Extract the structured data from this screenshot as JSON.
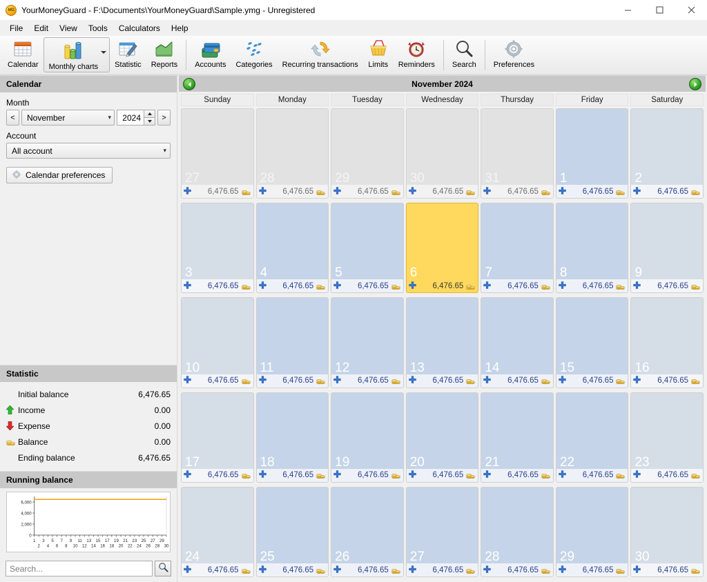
{
  "window": {
    "title": "YourMoneyGuard - F:\\Documents\\YourMoneyGuard\\Sample.ymg - Unregistered",
    "app_icon": "money-guard-icon",
    "minimize_label": "Minimize",
    "maximize_label": "Maximize",
    "close_label": "Close"
  },
  "menubar": {
    "items": [
      {
        "label": "File"
      },
      {
        "label": "Edit"
      },
      {
        "label": "View"
      },
      {
        "label": "Tools"
      },
      {
        "label": "Calculators"
      },
      {
        "label": "Help"
      }
    ]
  },
  "toolbar": {
    "items": [
      {
        "label": "Calendar",
        "icon": "calendar-icon",
        "active": false,
        "caret": false
      },
      {
        "label": "Monthly charts",
        "icon": "bar-chart-icon",
        "active": true,
        "caret": true
      },
      {
        "label": "Statistic",
        "icon": "statistic-icon",
        "active": false,
        "caret": false
      },
      {
        "label": "Reports",
        "icon": "reports-icon",
        "active": false,
        "caret": false
      },
      {
        "label": "Accounts",
        "icon": "credit-cards-icon",
        "active": false,
        "caret": false
      },
      {
        "label": "Categories",
        "icon": "categories-icon",
        "active": false,
        "caret": false
      },
      {
        "label": "Recurring transactions",
        "icon": "recurring-icon",
        "active": false,
        "caret": false
      },
      {
        "label": "Limits",
        "icon": "basket-icon",
        "active": false,
        "caret": false
      },
      {
        "label": "Reminders",
        "icon": "alarm-clock-icon",
        "active": false,
        "caret": false
      },
      {
        "label": "Search",
        "icon": "magnifier-icon",
        "active": false,
        "caret": false
      },
      {
        "label": "Preferences",
        "icon": "gear-icon",
        "active": false,
        "caret": false
      }
    ]
  },
  "sidebar": {
    "calendar_panel": {
      "header": "Calendar",
      "month_label": "Month",
      "prev_month_button": "<",
      "next_month_button": ">",
      "month_value": "November",
      "year_value": "2024",
      "account_label": "Account",
      "account_value": "All account",
      "preferences_button": "Calendar preferences"
    },
    "statistic_panel": {
      "header": "Statistic",
      "rows": [
        {
          "icon": "",
          "label": "Initial balance",
          "value": "6,476.65"
        },
        {
          "icon": "green-up-arrow-icon",
          "label": "Income",
          "value": "0.00"
        },
        {
          "icon": "red-down-arrow-icon",
          "label": "Expense",
          "value": "0.00"
        },
        {
          "icon": "coins-icon",
          "label": "Balance",
          "value": "0.00"
        },
        {
          "icon": "",
          "label": "Ending balance",
          "value": "6,476.65"
        }
      ]
    },
    "running_balance_panel": {
      "header": "Running balance"
    },
    "search": {
      "placeholder": "Search...",
      "value": "",
      "button_icon": "magnifier-icon"
    }
  },
  "calendar": {
    "title": "November 2024",
    "prev_arrow": "previous-month-arrow-icon",
    "next_arrow": "next-month-arrow-icon",
    "weekday_headers": [
      "Sunday",
      "Monday",
      "Tuesday",
      "Wednesday",
      "Thursday",
      "Friday",
      "Saturday"
    ],
    "add_icon": "blue-plus-icon",
    "balance_icon": "coins-icon",
    "colors": {
      "today": "#ffd95e",
      "weekday": "#c5d4e8",
      "weekend": "#d5dde7",
      "other_month": "#e2e2e2",
      "amount_text": "#2b3f8f",
      "panel_header": "#c8c8c8"
    },
    "weeks": [
      [
        {
          "day": "27",
          "amount": "6,476.65",
          "other": true,
          "today": false,
          "col": 0
        },
        {
          "day": "28",
          "amount": "6,476.65",
          "other": true,
          "today": false,
          "col": 1
        },
        {
          "day": "29",
          "amount": "6,476.65",
          "other": true,
          "today": false,
          "col": 2
        },
        {
          "day": "30",
          "amount": "6,476.65",
          "other": true,
          "today": false,
          "col": 3
        },
        {
          "day": "31",
          "amount": "6,476.65",
          "other": true,
          "today": false,
          "col": 4
        },
        {
          "day": "1",
          "amount": "6,476.65",
          "other": false,
          "today": false,
          "col": 5
        },
        {
          "day": "2",
          "amount": "6,476.65",
          "other": false,
          "today": false,
          "col": 6
        }
      ],
      [
        {
          "day": "3",
          "amount": "6,476.65",
          "other": false,
          "today": false,
          "col": 0
        },
        {
          "day": "4",
          "amount": "6,476.65",
          "other": false,
          "today": false,
          "col": 1
        },
        {
          "day": "5",
          "amount": "6,476.65",
          "other": false,
          "today": false,
          "col": 2
        },
        {
          "day": "6",
          "amount": "6,476.65",
          "other": false,
          "today": true,
          "col": 3
        },
        {
          "day": "7",
          "amount": "6,476.65",
          "other": false,
          "today": false,
          "col": 4
        },
        {
          "day": "8",
          "amount": "6,476.65",
          "other": false,
          "today": false,
          "col": 5
        },
        {
          "day": "9",
          "amount": "6,476.65",
          "other": false,
          "today": false,
          "col": 6
        }
      ],
      [
        {
          "day": "10",
          "amount": "6,476.65",
          "other": false,
          "today": false,
          "col": 0
        },
        {
          "day": "11",
          "amount": "6,476.65",
          "other": false,
          "today": false,
          "col": 1
        },
        {
          "day": "12",
          "amount": "6,476.65",
          "other": false,
          "today": false,
          "col": 2
        },
        {
          "day": "13",
          "amount": "6,476.65",
          "other": false,
          "today": false,
          "col": 3
        },
        {
          "day": "14",
          "amount": "6,476.65",
          "other": false,
          "today": false,
          "col": 4
        },
        {
          "day": "15",
          "amount": "6,476.65",
          "other": false,
          "today": false,
          "col": 5
        },
        {
          "day": "16",
          "amount": "6,476.65",
          "other": false,
          "today": false,
          "col": 6
        }
      ],
      [
        {
          "day": "17",
          "amount": "6,476.65",
          "other": false,
          "today": false,
          "col": 0
        },
        {
          "day": "18",
          "amount": "6,476.65",
          "other": false,
          "today": false,
          "col": 1
        },
        {
          "day": "19",
          "amount": "6,476.65",
          "other": false,
          "today": false,
          "col": 2
        },
        {
          "day": "20",
          "amount": "6,476.65",
          "other": false,
          "today": false,
          "col": 3
        },
        {
          "day": "21",
          "amount": "6,476.65",
          "other": false,
          "today": false,
          "col": 4
        },
        {
          "day": "22",
          "amount": "6,476.65",
          "other": false,
          "today": false,
          "col": 5
        },
        {
          "day": "23",
          "amount": "6,476.65",
          "other": false,
          "today": false,
          "col": 6
        }
      ],
      [
        {
          "day": "24",
          "amount": "6,476.65",
          "other": false,
          "today": false,
          "col": 0
        },
        {
          "day": "25",
          "amount": "6,476.65",
          "other": false,
          "today": false,
          "col": 1
        },
        {
          "day": "26",
          "amount": "6,476.65",
          "other": false,
          "today": false,
          "col": 2
        },
        {
          "day": "27",
          "amount": "6,476.65",
          "other": false,
          "today": false,
          "col": 3
        },
        {
          "day": "28",
          "amount": "6,476.65",
          "other": false,
          "today": false,
          "col": 4
        },
        {
          "day": "29",
          "amount": "6,476.65",
          "other": false,
          "today": false,
          "col": 5
        },
        {
          "day": "30",
          "amount": "6,476.65",
          "other": false,
          "today": false,
          "col": 6
        }
      ]
    ]
  },
  "chart_data": {
    "type": "line",
    "title": "Running balance",
    "xlabel": "",
    "ylabel": "",
    "x": [
      1,
      2,
      3,
      4,
      5,
      6,
      7,
      8,
      9,
      10,
      11,
      12,
      13,
      14,
      15,
      16,
      17,
      18,
      19,
      20,
      21,
      22,
      23,
      24,
      25,
      26,
      27,
      28,
      29,
      30
    ],
    "values": [
      6476.65,
      6476.65,
      6476.65,
      6476.65,
      6476.65,
      6476.65,
      6476.65,
      6476.65,
      6476.65,
      6476.65,
      6476.65,
      6476.65,
      6476.65,
      6476.65,
      6476.65,
      6476.65,
      6476.65,
      6476.65,
      6476.65,
      6476.65,
      6476.65,
      6476.65,
      6476.65,
      6476.65,
      6476.65,
      6476.65,
      6476.65,
      6476.65,
      6476.65,
      6476.65
    ],
    "series": [
      {
        "name": "Running balance",
        "color": "#f5a623",
        "values": [
          6476.65,
          6476.65,
          6476.65,
          6476.65,
          6476.65,
          6476.65,
          6476.65,
          6476.65,
          6476.65,
          6476.65,
          6476.65,
          6476.65,
          6476.65,
          6476.65,
          6476.65,
          6476.65,
          6476.65,
          6476.65,
          6476.65,
          6476.65,
          6476.65,
          6476.65,
          6476.65,
          6476.65,
          6476.65,
          6476.65,
          6476.65,
          6476.65,
          6476.65,
          6476.65
        ]
      }
    ],
    "ylim": [
      0,
      7000
    ],
    "yticks": [
      0,
      2000,
      4000,
      6000
    ],
    "ytick_labels": [
      "0",
      "2,000",
      "4,000",
      "6,000"
    ],
    "xticks": [
      1,
      2,
      3,
      4,
      5,
      6,
      7,
      8,
      9,
      10,
      11,
      12,
      13,
      14,
      15,
      16,
      17,
      18,
      19,
      20,
      21,
      22,
      23,
      24,
      25,
      26,
      27,
      28,
      29,
      30
    ],
    "grid": false,
    "legend": "none"
  }
}
